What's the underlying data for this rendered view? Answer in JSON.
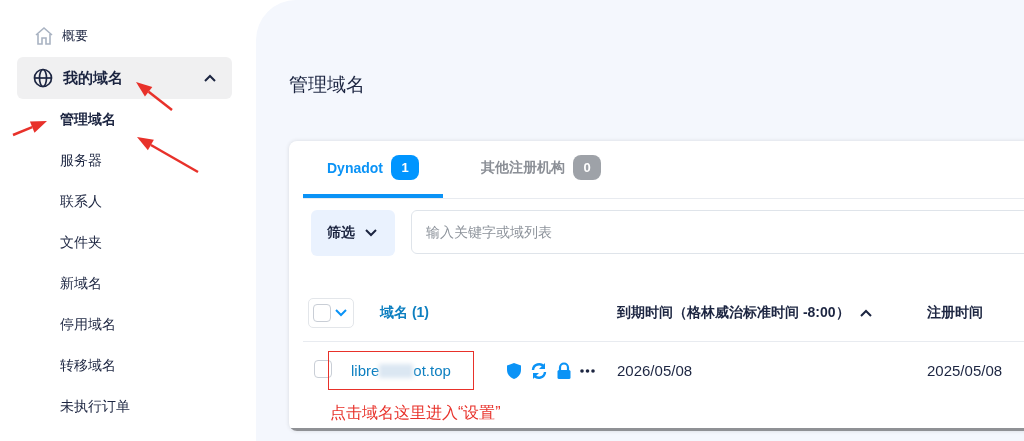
{
  "sidebar": {
    "items": [
      {
        "label": "概要",
        "kind": "link"
      },
      {
        "label": "我的域名",
        "kind": "group",
        "expanded": true,
        "children": [
          {
            "label": "管理域名",
            "selected": true
          },
          {
            "label": "服务器",
            "selected": false
          },
          {
            "label": "联系人",
            "selected": false
          },
          {
            "label": "文件夹",
            "selected": false
          },
          {
            "label": "新域名",
            "selected": false
          },
          {
            "label": "停用域名",
            "selected": false
          },
          {
            "label": "转移域名",
            "selected": false
          },
          {
            "label": "未执行订单",
            "selected": false
          }
        ]
      }
    ]
  },
  "page_title": "管理域名",
  "tabs": [
    {
      "label": "Dynadot",
      "count": "1",
      "selected": true
    },
    {
      "label": "其他注册机构",
      "count": "0",
      "selected": false
    }
  ],
  "filter": {
    "label": "筛选"
  },
  "search": {
    "placeholder": "输入关键字或域列表"
  },
  "table": {
    "select_all": {
      "checked": false
    },
    "columns": [
      {
        "label": "域名 (1)",
        "kind": "link"
      },
      {
        "label": "到期时间（格林威治标准时间 -8:00）",
        "kind": "text",
        "sorted_ascending": true
      },
      {
        "label": "注册时间",
        "kind": "text"
      }
    ],
    "rows": [
      {
        "checked": false,
        "domain_start": "libre",
        "domain_end": "ot.top",
        "expiry": "2026/05/08",
        "registered": "2025/05/08"
      }
    ]
  },
  "annotation": {
    "caption": "点击域名这里进入“设置”"
  }
}
